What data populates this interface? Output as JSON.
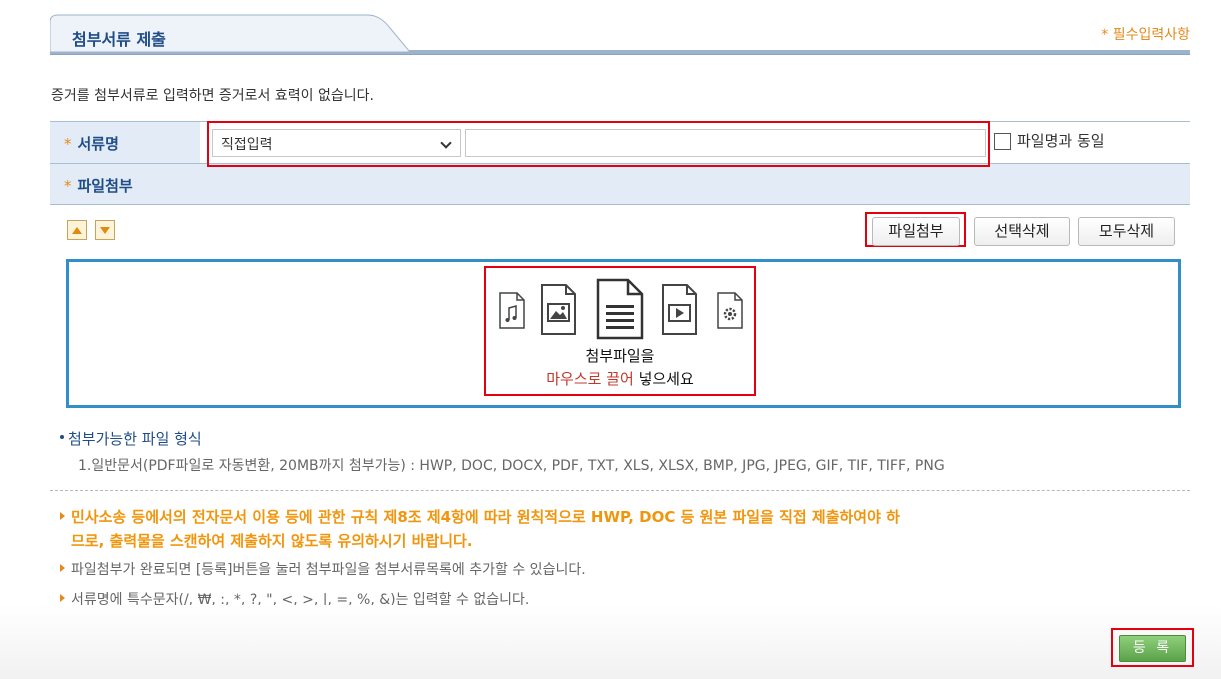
{
  "header": {
    "title": "첨부서류 제출",
    "required_note": "* 필수입력사항"
  },
  "notice": "증거를 첨부서류로 입력하면 증거로서 효력이 없습니다.",
  "form": {
    "doc_name_label": "서류명",
    "star": "*",
    "doc_type_select": "직접입력",
    "doc_name_value": "",
    "same_as_filename_label": "파일명과 동일",
    "same_as_filename_checked": false,
    "file_attach_label": "파일첨부"
  },
  "toolbar": {
    "attach_button": "파일첨부",
    "delete_selected_button": "선택삭제",
    "delete_all_button": "모두삭제"
  },
  "dropzone": {
    "line1": "첨부파일을",
    "line2_highlight": "마우스로 끌어",
    "line2_rest": "넣으세요",
    "icons": [
      "music-file-icon",
      "image-file-icon",
      "document-file-icon",
      "video-file-icon",
      "settings-file-icon"
    ]
  },
  "formats": {
    "title": "첨부가능한 파일 형식",
    "line": "1.일반문서(PDF파일로 자동변환, 20MB까지 첨부가능) : HWP, DOC, DOCX, PDF, TXT, XLS, XLSX, BMP, JPG, JPEG, GIF, TIF, TIFF, PNG"
  },
  "notes": {
    "warning_line1": "민사소송 등에서의 전자문서 이용 등에 관한 규칙 제8조 제4항에 따라 원칙적으로 HWP, DOC 등 원본 파일을 직접 제출하여야 하",
    "warning_line2": "므로, 출력물을 스캔하여 제출하지 않도록 유의하시기 바랍니다.",
    "info1": "파일첨부가 완료되면 [등록]버튼을 눌러 첨부파일을 첨부서류목록에 추가할 수 있습니다.",
    "info2": "서류명에 특수문자(/, ₩, :, *, ?, \", <, >, |, =, %, &)는 입력할 수 없습니다."
  },
  "register_button": "등 록",
  "colors": {
    "accent_blue": "#1f4d87",
    "accent_orange": "#f0960e",
    "highlight_red": "#e3000f",
    "register_green": "#5ba24a"
  }
}
